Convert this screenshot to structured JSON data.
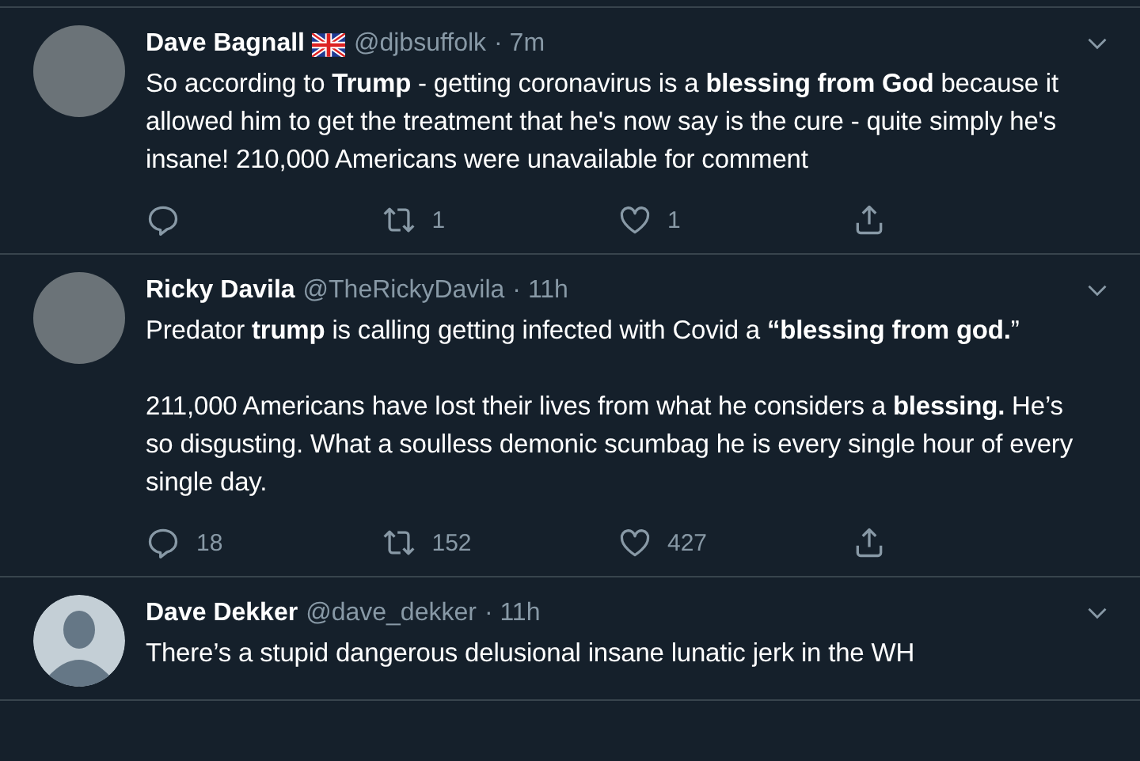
{
  "tweets": [
    {
      "name": "Dave Bagnall",
      "flag": true,
      "avatar": {
        "kind": "photo"
      },
      "handle": "@djbsuffolk",
      "time": "· 7m",
      "paragraphs": [
        "So according to **Trump** - getting coronavirus is a **blessing from God** because it allowed him to get the treatment that he's now say is the cure - quite simply he's insane! 210,000 Americans were unavailable for comment"
      ],
      "actions": {
        "retweets": "1",
        "likes": "1"
      }
    },
    {
      "name": "Ricky Davila",
      "flag": false,
      "avatar": {
        "kind": "photo"
      },
      "handle": "@TheRickyDavila",
      "time": "· 11h",
      "paragraphs": [
        "Predator **trump** is calling getting infected with Covid a **“blessing from god.**”",
        "211,000 Americans have lost their lives from what he considers a **blessing.** He’s so disgusting. What a soulless demonic scumbag he is every single hour of every single day."
      ],
      "actions": {
        "replies": "18",
        "retweets": "152",
        "likes": "427"
      }
    },
    {
      "name": "Dave Dekker",
      "flag": false,
      "avatar": {
        "kind": "default"
      },
      "handle": "@dave_dekker",
      "time": "· 11h",
      "paragraphs": [
        "There’s a stupid dangerous delusional insane lunatic jerk in the WH"
      ]
    }
  ]
}
